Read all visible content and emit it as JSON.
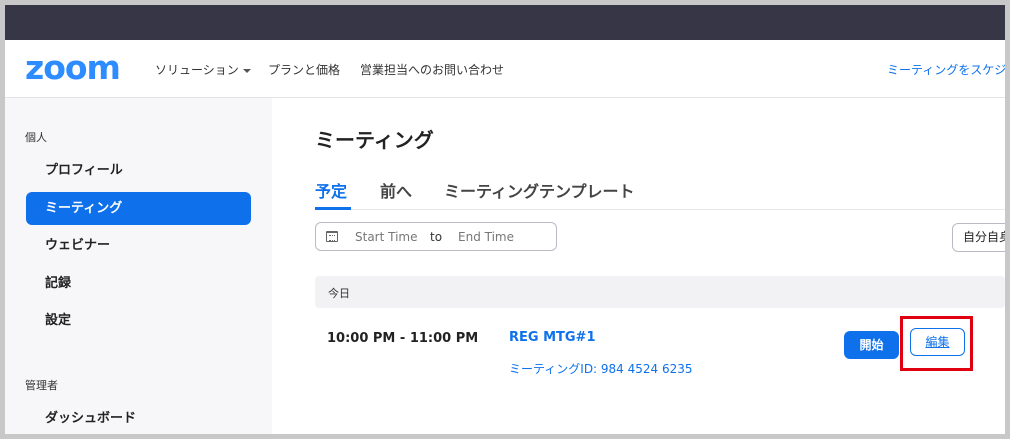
{
  "header": {
    "logo": "zoom",
    "nav": [
      {
        "label": "ソリューション"
      },
      {
        "label": "プランと価格"
      },
      {
        "label": "営業担当へのお問い合わせ"
      }
    ],
    "schedule_link": "ミーティングをスケジュ"
  },
  "sidebar": {
    "personal_heading": "個人",
    "items": [
      {
        "label": "プロフィール"
      },
      {
        "label": "ミーティング"
      },
      {
        "label": "ウェビナー"
      },
      {
        "label": "記録"
      },
      {
        "label": "設定"
      }
    ],
    "admin_heading": "管理者",
    "admin_items": [
      {
        "label": "ダッシュボード"
      }
    ]
  },
  "main": {
    "title": "ミーティング",
    "tabs": [
      {
        "label": "予定"
      },
      {
        "label": "前へ"
      },
      {
        "label": "ミーティングテンプレート"
      }
    ],
    "date_range": {
      "start": "Start Time",
      "to": "to",
      "end": "End Time"
    },
    "timezone_button": "自分自身",
    "day_label": "今日",
    "meeting": {
      "time": "10:00 PM - 11:00 PM",
      "title": "REG MTG#1",
      "id_text": "ミーティングID: 984 4524 6235",
      "start_label": "開始",
      "edit_label": "編集"
    }
  },
  "colors": {
    "accent": "#0e71eb",
    "logo": "#2d8cff",
    "highlight": "#e00010",
    "topbar": "#363646"
  }
}
